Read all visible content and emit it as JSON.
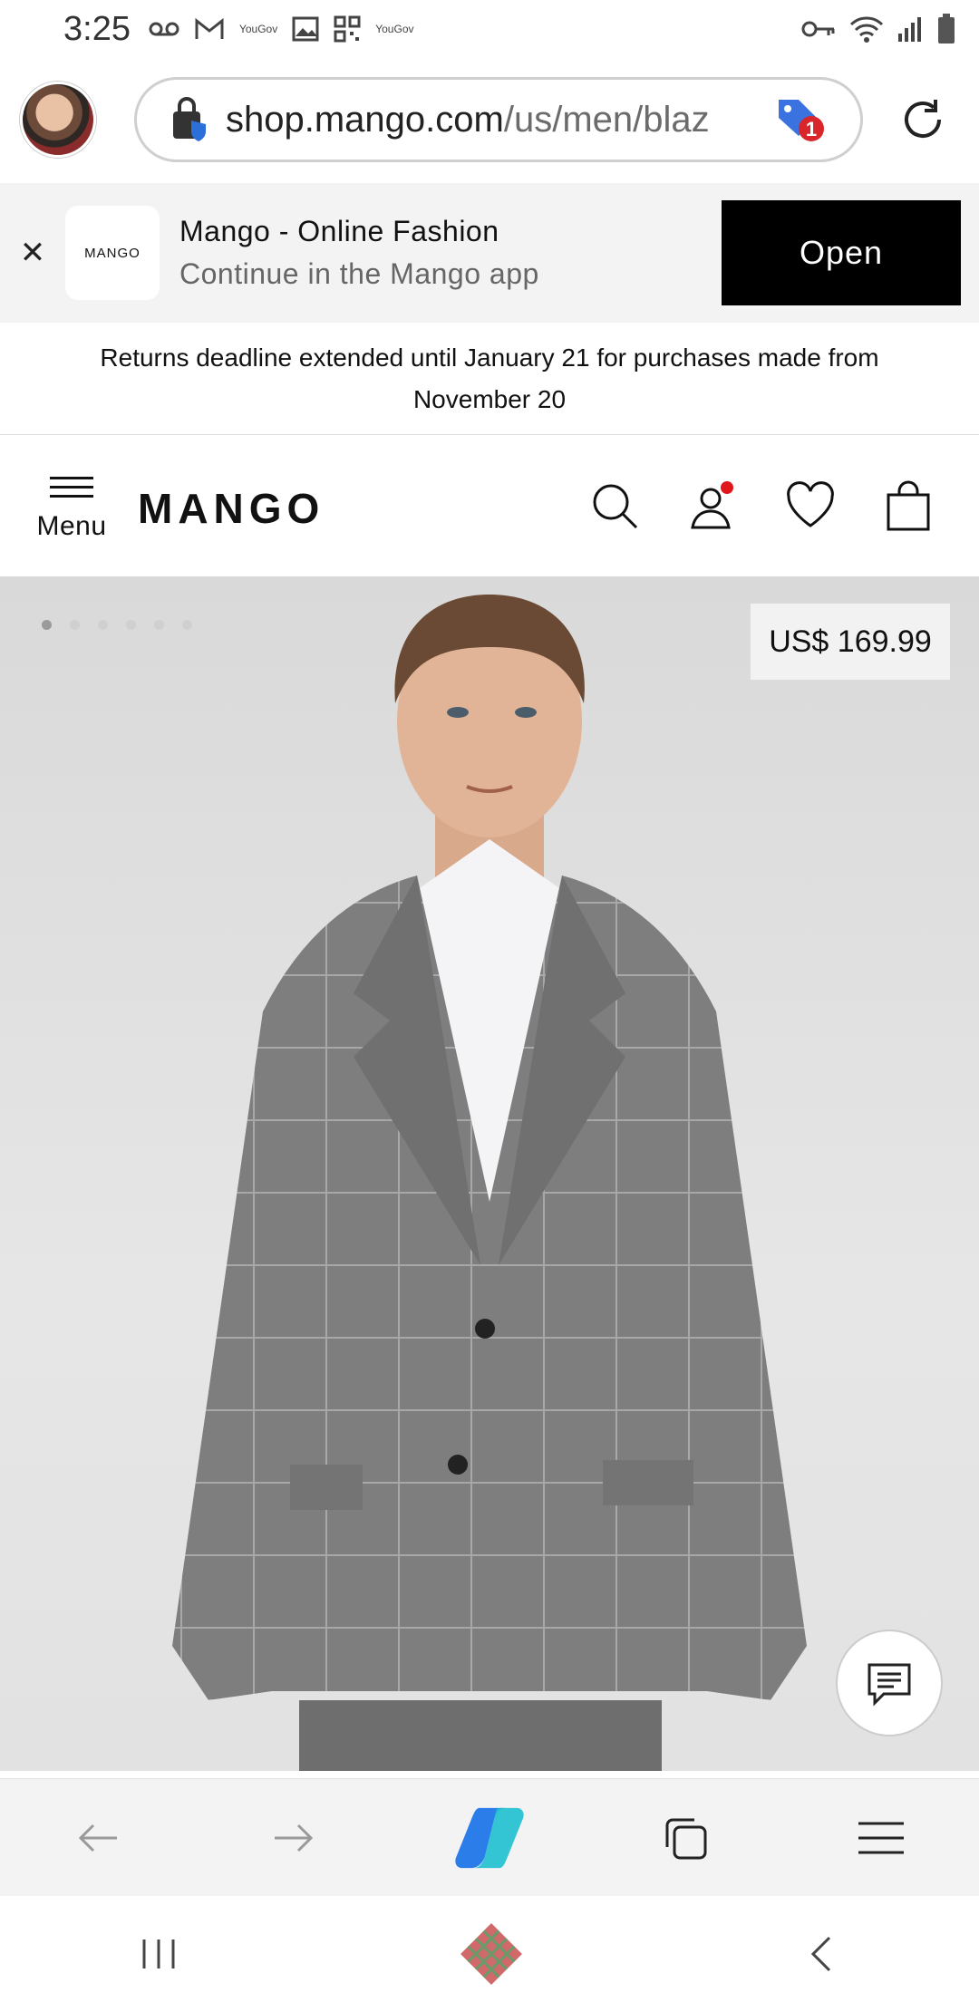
{
  "status_bar": {
    "time": "3:25",
    "left_icons": [
      "voicemail-icon",
      "gmail-icon",
      "yougov-icon",
      "gallery-icon",
      "qr-icon",
      "yougov-icon"
    ],
    "yougov_text": "YouGov",
    "right_icons": [
      "key-icon",
      "wifi-icon",
      "signal-icon",
      "battery-icon"
    ]
  },
  "browser": {
    "url_host": "shop.mango.com",
    "url_path": "/us/men/blaz",
    "coupon_badge": "1"
  },
  "app_banner": {
    "logo_text": "MANGO",
    "title": "Mango - Online Fashion",
    "subtitle": "Continue in the Mango app",
    "open_label": "Open"
  },
  "announcement": {
    "text": "Returns deadline extended until January 21 for purchases made from November 20"
  },
  "header": {
    "menu_label": "Menu",
    "brand": "MANGO"
  },
  "product": {
    "price": "US$ 169.99",
    "gallery_dots": 6,
    "active_dot": 0
  },
  "colors": {
    "banner_bg": "#f3f3f3",
    "open_button": "#000000",
    "notification_dot": "#e0161b",
    "jacket_gray": "#7c7c7c",
    "background_gray": "#dedede"
  }
}
